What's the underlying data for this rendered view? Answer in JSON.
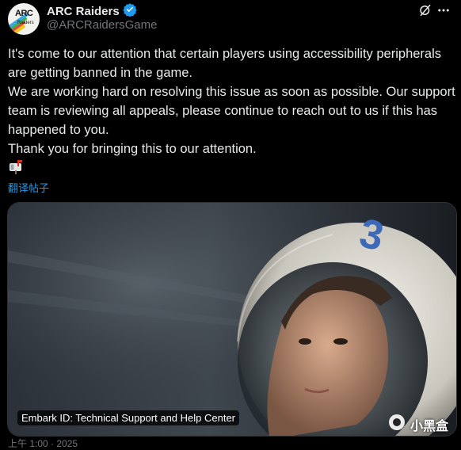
{
  "account": {
    "name": "ARC Raiders",
    "handle": "@ARCRaidersGame",
    "avatar_text": "ARC",
    "avatar_subtext": "Raiders"
  },
  "tweet": {
    "text": "It's come to our attention that certain players using accessibility peripherals are getting banned in the game.\nWe are working hard on resolving this issue as soon as possible. Our support team is reviewing all appeals, please continue to reach out to us if this has happened to you.\nThank you for bringing this to our attention.",
    "emoji_icon": "mailbox-icon",
    "translate_label": "翻译帖子"
  },
  "media": {
    "caption": "Embark ID: Technical Support and Help Center",
    "helmet_number": "3"
  },
  "watermark": {
    "text": "小黑盒"
  },
  "footer": {
    "text": "上午 1:00 · 2025"
  },
  "colors": {
    "background": "#000000",
    "text": "#e7e9ea",
    "muted": "#71767b",
    "link": "#1d9bf0",
    "verified": "#1d9bf0"
  }
}
